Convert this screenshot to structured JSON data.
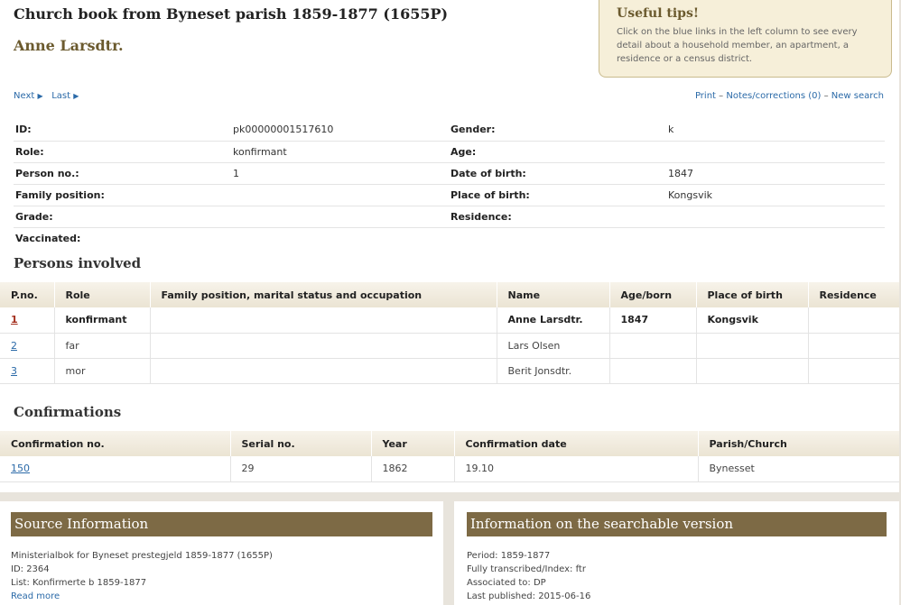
{
  "header": {
    "title": "Church book from Byneset parish 1859-1877 (1655P)",
    "person_name": "Anne Larsdtr."
  },
  "tips": {
    "title": "Useful tips!",
    "text": "Click on the blue links in the left column to see every detail about a household member, an apartment, a residence or a census district."
  },
  "nav": {
    "next": "Next",
    "last": "Last",
    "print": "Print",
    "notes": "Notes/corrections (0)",
    "new_search": "New search",
    "sep": "–"
  },
  "details": {
    "rows": [
      {
        "l1": "ID:",
        "v1": "pk00000001517610",
        "l2": "Gender:",
        "v2": "k"
      },
      {
        "l1": "Role:",
        "v1": "konfirmant",
        "l2": "Age:",
        "v2": ""
      },
      {
        "l1": "Person no.:",
        "v1": "1",
        "l2": "Date of birth:",
        "v2": "1847"
      },
      {
        "l1": "Family position:",
        "v1": "",
        "l2": "Place of birth:",
        "v2": "Kongsvik"
      },
      {
        "l1": "Grade:",
        "v1": "",
        "l2": "Residence:",
        "v2": ""
      },
      {
        "l1": "Vaccinated:",
        "v1": "",
        "l2": "",
        "v2": ""
      }
    ]
  },
  "persons": {
    "heading": "Persons involved",
    "columns": [
      "P.no.",
      "Role",
      "Family position, marital status and occupation",
      "Name",
      "Age/born",
      "Place of birth",
      "Residence"
    ],
    "rows": [
      {
        "pno": "1",
        "role": "konfirmant",
        "family": "",
        "name": "Anne Larsdtr.",
        "age": "1847",
        "place": "Kongsvik",
        "residence": ""
      },
      {
        "pno": "2",
        "role": "far",
        "family": "",
        "name": "Lars Olsen",
        "age": "",
        "place": "",
        "residence": ""
      },
      {
        "pno": "3",
        "role": "mor",
        "family": "",
        "name": "Berit Jonsdtr.",
        "age": "",
        "place": "",
        "residence": ""
      }
    ]
  },
  "confirmations": {
    "heading": "Confirmations",
    "columns": [
      "Confirmation no.",
      "Serial no.",
      "Year",
      "Confirmation date",
      "Parish/Church"
    ],
    "rows": [
      {
        "no": "150",
        "serial": "29",
        "year": "1862",
        "date": "19.10",
        "parish": "Bynesset"
      }
    ]
  },
  "source": {
    "heading": "Source Information",
    "line1": "Ministerialbok for Byneset prestegjeld 1859-1877 (1655P)",
    "line2": "ID: 2364",
    "line3": "List: Konfirmerte b 1859-1877",
    "read_more": "Read more"
  },
  "searchable": {
    "heading": "Information on the searchable version",
    "line1": "Period: 1859-1877",
    "line2": "Fully transcribed/Index: ftr",
    "line3": "Associated to: DP",
    "line4": "Last published: 2015-06-16"
  },
  "colors": {
    "link": "#2b6aa8",
    "brand_brown": "#7d6a45",
    "tips_bg": "#f6efd9",
    "name_color": "#6b5a2e"
  },
  "icons": {
    "next": "triangle-right-icon",
    "last": "triangle-right-icon"
  }
}
